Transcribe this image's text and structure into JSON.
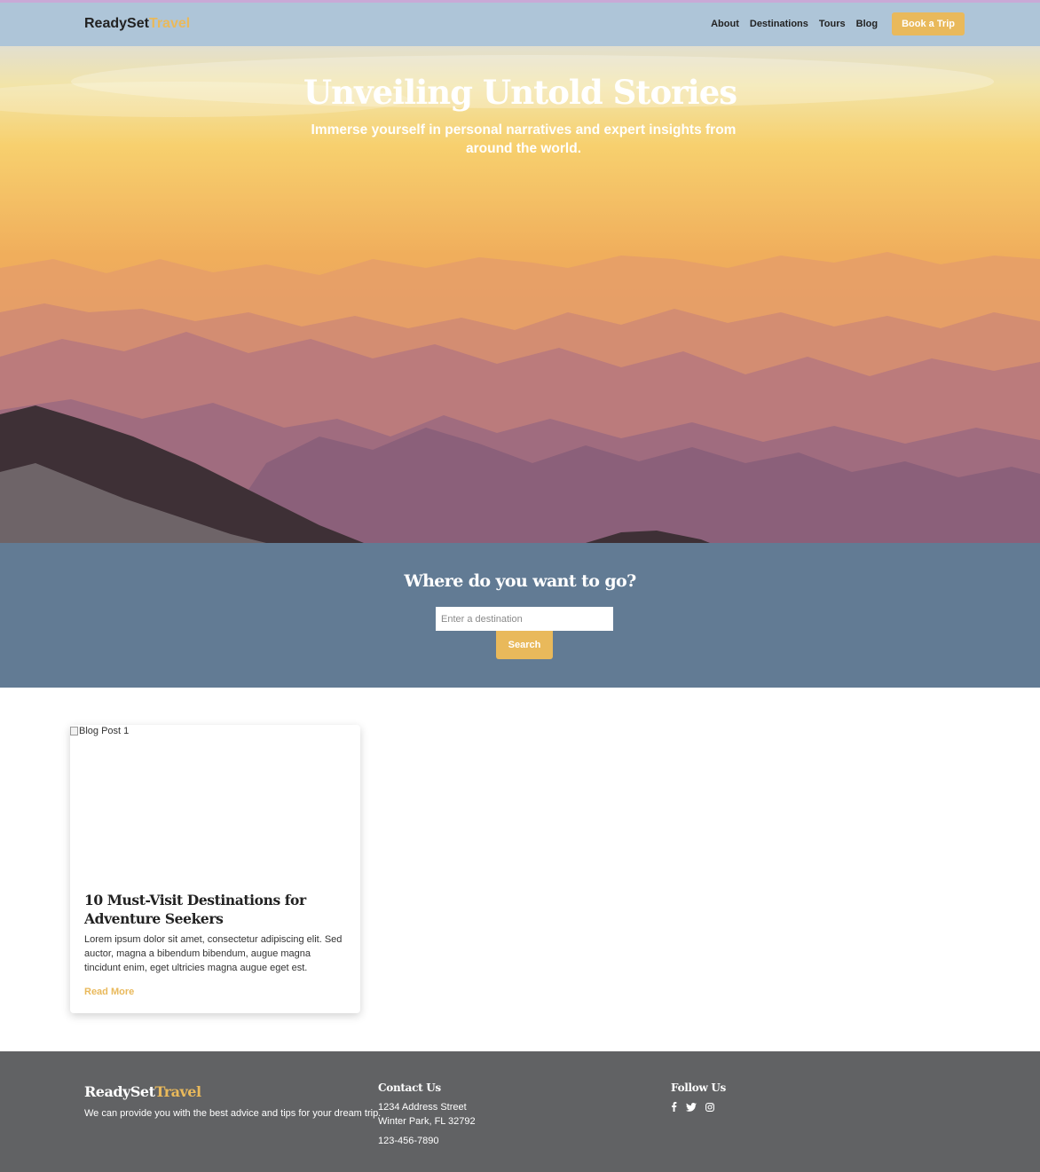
{
  "header": {
    "logo_part1": "ReadySet",
    "logo_part2": "Travel",
    "nav": [
      "About",
      "Destinations",
      "Tours",
      "Blog"
    ],
    "cta": "Book a Trip"
  },
  "hero": {
    "title": "Unveiling Untold Stories",
    "subtitle": "Immerse yourself in personal narratives and expert insights from around the world."
  },
  "search": {
    "heading": "Where do you want to go?",
    "placeholder": "Enter a destination",
    "button": "Search"
  },
  "blog": {
    "posts": [
      {
        "image_alt": "Blog Post 1",
        "title": "10 Must-Visit Destinations for Adventure Seekers",
        "excerpt": "Lorem ipsum dolor sit amet, consectetur adipiscing elit. Sed auctor, magna a bibendum bibendum, augue magna tincidunt enim, eget ultricies magna augue eget est.",
        "link": "Read More"
      }
    ]
  },
  "footer": {
    "logo_part1": "ReadySet",
    "logo_part2": "Travel",
    "description": "We can provide you with the best advice and tips for your dream trip.",
    "contact_heading": "Contact Us",
    "address_line1": "1234 Address Street",
    "address_line2": "Winter Park, FL 32792",
    "phone": "123-456-7890",
    "follow_heading": "Follow Us",
    "social_icons": [
      "facebook-icon",
      "twitter-icon",
      "instagram-icon"
    ]
  },
  "colors": {
    "accent": "#e9b95b",
    "header_bg": "#aec5d8",
    "search_bg": "#627b94",
    "footer_bg": "#616264"
  }
}
